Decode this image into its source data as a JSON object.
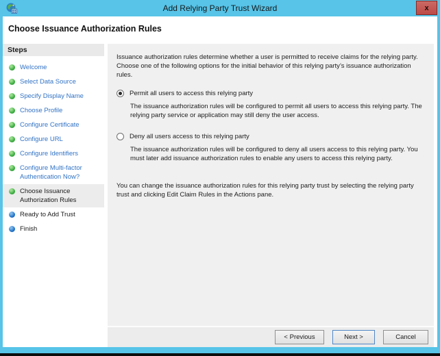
{
  "window": {
    "title": "Add Relying Party Trust Wizard",
    "close_label": "x",
    "page_title": "Choose Issuance Authorization Rules"
  },
  "colors": {
    "titlebar_blue": "#57C4E8",
    "close_red": "#C0504E",
    "content_bg": "#F0F0F0",
    "link_blue": "#3273C5",
    "done_dot_green": "#3DAC42",
    "upcoming_dot_blue": "#2473C8",
    "next_button_border": "#4F86C6"
  },
  "sidebar": {
    "header": "Steps",
    "items": [
      {
        "label": "Welcome",
        "status": "done"
      },
      {
        "label": "Select Data Source",
        "status": "done"
      },
      {
        "label": "Specify Display Name",
        "status": "done"
      },
      {
        "label": "Choose Profile",
        "status": "done"
      },
      {
        "label": "Configure Certificate",
        "status": "done"
      },
      {
        "label": "Configure URL",
        "status": "done"
      },
      {
        "label": "Configure Identifiers",
        "status": "done"
      },
      {
        "label": "Configure Multi-factor Authentication Now?",
        "status": "done"
      },
      {
        "label": "Choose Issuance Authorization Rules",
        "status": "current"
      },
      {
        "label": "Ready to Add Trust",
        "status": "upcoming"
      },
      {
        "label": "Finish",
        "status": "upcoming"
      }
    ]
  },
  "content": {
    "intro": "Issuance authorization rules determine whether a user is permitted to receive claims for the relying party. Choose one of the following options for the initial behavior of this relying party’s issuance authorization rules.",
    "options": [
      {
        "label": "Permit all users to access this relying party",
        "selected": true,
        "description": "The issuance authorization rules will be configured to permit all users to access this relying party. The relying party service or application may still deny the user access."
      },
      {
        "label": "Deny all users access to this relying party",
        "selected": false,
        "description": "The issuance authorization rules will be configured to deny all users access to this relying party. You must later add issuance authorization rules to enable any users to access this relying party."
      }
    ],
    "footer": "You can change the issuance authorization rules for this relying party trust by selecting the relying party trust and clicking Edit Claim Rules in the Actions pane."
  },
  "buttons": {
    "previous": "< Previous",
    "next": "Next >",
    "cancel": "Cancel"
  }
}
